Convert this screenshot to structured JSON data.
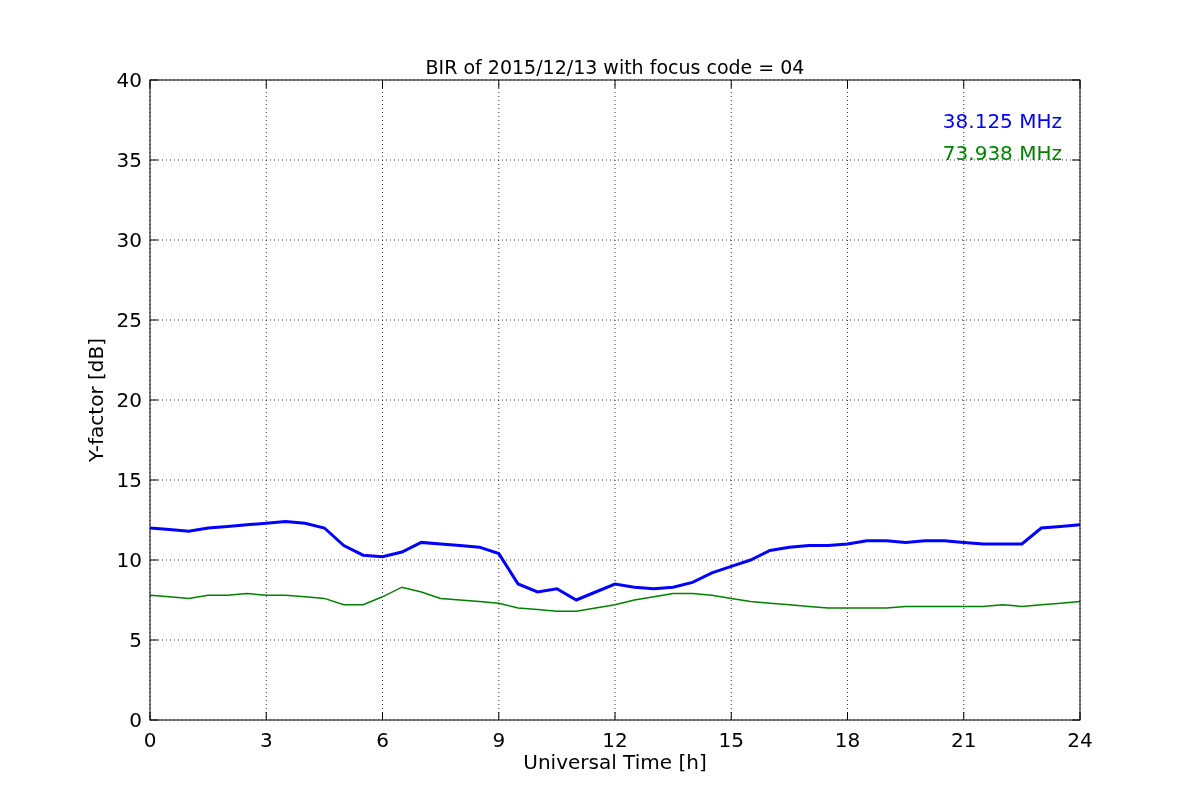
{
  "figure": {
    "chart_data": {
      "type": "line",
      "title": "BIR of 2015/12/13 with focus code = 04",
      "xlabel": "Universal Time [h]",
      "ylabel": "Y-factor [dB]",
      "x": [
        0,
        0.5,
        1,
        1.5,
        2,
        2.5,
        3,
        3.5,
        4,
        4.5,
        5,
        5.5,
        6,
        6.5,
        7,
        7.5,
        8,
        8.5,
        9,
        9.5,
        10,
        10.5,
        11,
        11.5,
        12,
        12.5,
        13,
        13.5,
        14,
        14.5,
        15,
        15.5,
        16,
        16.5,
        17,
        17.5,
        18,
        18.5,
        19,
        19.5,
        20,
        20.5,
        21,
        21.5,
        22,
        22.5,
        23,
        23.5,
        24
      ],
      "series": [
        {
          "name": "38.125 MHz",
          "color": "#0000ff",
          "values": [
            12.0,
            11.9,
            11.8,
            12.0,
            12.1,
            12.2,
            12.3,
            12.4,
            12.3,
            12.0,
            10.9,
            10.3,
            10.2,
            10.5,
            11.1,
            11.0,
            10.9,
            10.8,
            10.4,
            8.5,
            8.0,
            8.2,
            7.5,
            8.0,
            8.5,
            8.3,
            8.2,
            8.3,
            8.6,
            9.2,
            9.6,
            10.0,
            10.6,
            10.8,
            10.9,
            10.9,
            11.0,
            11.2,
            11.2,
            11.1,
            11.2,
            11.2,
            11.1,
            11.0,
            11.0,
            11.0,
            12.0,
            12.1,
            12.2
          ]
        },
        {
          "name": "73.938 MHz",
          "color": "#008000",
          "values": [
            7.8,
            7.7,
            7.6,
            7.8,
            7.8,
            7.9,
            7.8,
            7.8,
            7.7,
            7.6,
            7.2,
            7.2,
            7.7,
            8.3,
            8.0,
            7.6,
            7.5,
            7.4,
            7.3,
            7.0,
            6.9,
            6.8,
            6.8,
            7.0,
            7.2,
            7.5,
            7.7,
            7.9,
            7.9,
            7.8,
            7.6,
            7.4,
            7.3,
            7.2,
            7.1,
            7.0,
            7.0,
            7.0,
            7.0,
            7.1,
            7.1,
            7.1,
            7.1,
            7.1,
            7.2,
            7.1,
            7.2,
            7.3,
            7.4
          ]
        }
      ],
      "grid": true,
      "xlim": [
        0,
        24
      ],
      "ylim": [
        0,
        40
      ],
      "xticks": [
        0,
        3,
        6,
        9,
        12,
        15,
        18,
        21,
        24
      ],
      "yticks": [
        0,
        5,
        10,
        15,
        20,
        25,
        30,
        35,
        40
      ]
    }
  }
}
